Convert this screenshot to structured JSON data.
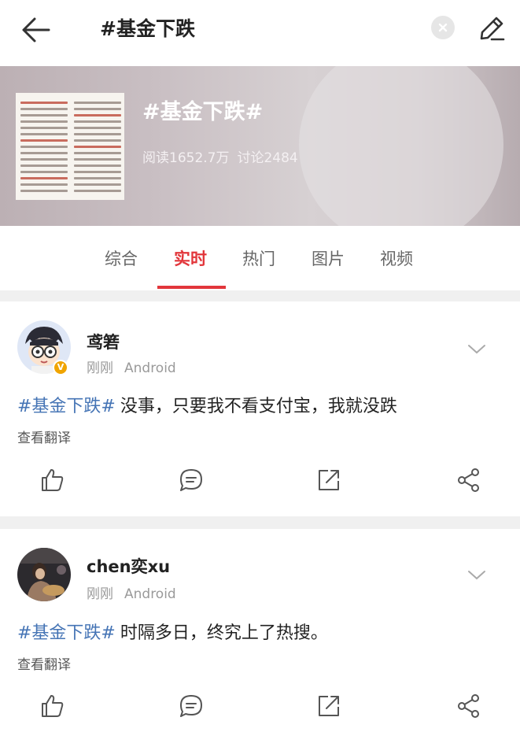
{
  "header": {
    "search_text": "#基金下跌",
    "back_icon": "back-arrow-icon",
    "clear_icon": "clear-icon",
    "edit_icon": "pencil-edit-icon"
  },
  "topic": {
    "title": "#基金下跌#",
    "reads": "阅读1652.7万",
    "discussions": "讨论2484"
  },
  "tabs": [
    {
      "label": "综合"
    },
    {
      "label": "实时",
      "active": true
    },
    {
      "label": "热门"
    },
    {
      "label": "图片"
    },
    {
      "label": "视频"
    }
  ],
  "accent_color": "#e2363b",
  "hashtag_color": "#4574b5",
  "posts": [
    {
      "username": "鸢箬",
      "time": "刚刚",
      "source": "Android",
      "verified": true,
      "hashtag": "#基金下跌#",
      "text": "没事，只要我不看支付宝，我就没跌",
      "translate": "查看翻译"
    },
    {
      "username": "chen奕xu",
      "time": "刚刚",
      "source": "Android",
      "verified": false,
      "hashtag": "#基金下跌#",
      "text": "时隔多日，终究上了热搜。",
      "translate": "查看翻译"
    }
  ],
  "actions": [
    "like-icon",
    "comment-icon",
    "repost-icon",
    "share-icon"
  ]
}
